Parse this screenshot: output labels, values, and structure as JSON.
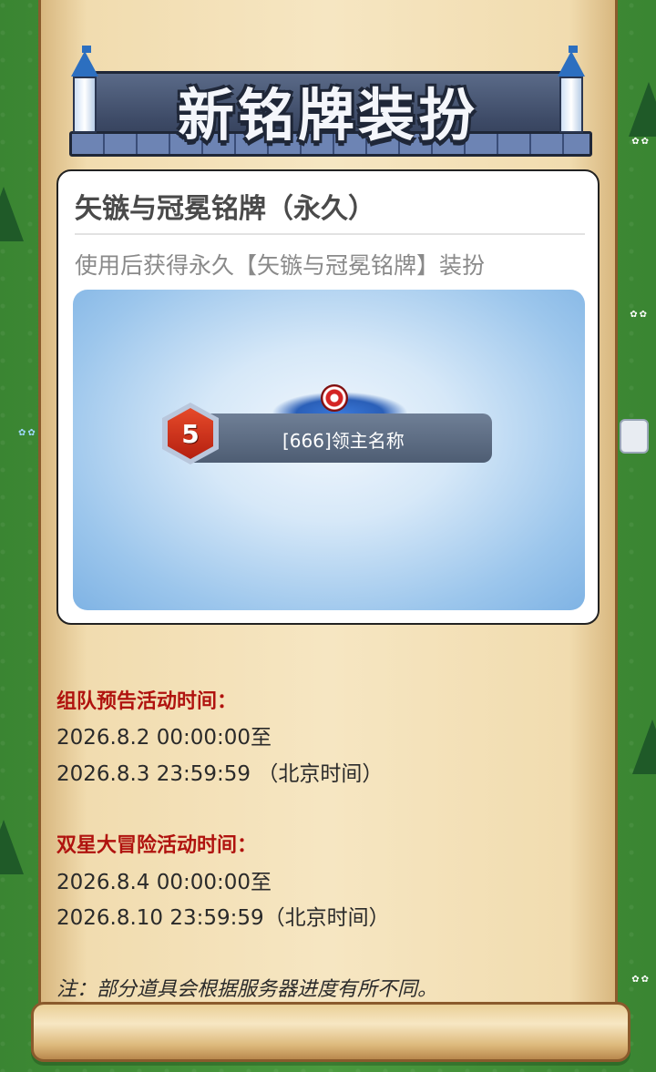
{
  "banner": {
    "title": "新铭牌装扮"
  },
  "item": {
    "title": "矢镞与冠冕铭牌（永久）",
    "description": "使用后获得永久【矢镞与冠冕铭牌】装扮",
    "preview": {
      "level": "5",
      "player_name": "[666]领主名称"
    }
  },
  "schedule": {
    "team_preview": {
      "heading": "组队预告活动时间：",
      "start": "2026.8.2 00:00:00至",
      "end": "2026.8.3 23:59:59 （北京时间）"
    },
    "double_star": {
      "heading": "双星大冒险活动时间：",
      "start": "2026.8.4 00:00:00至",
      "end": "2026.8.10 23:59:59（北京时间）"
    }
  },
  "note": "注：部分道具会根据服务器进度有所不同。",
  "colors": {
    "heading_red": "#b0130f",
    "grass_green": "#3f8a36",
    "parchment": "#f6e6c2"
  }
}
